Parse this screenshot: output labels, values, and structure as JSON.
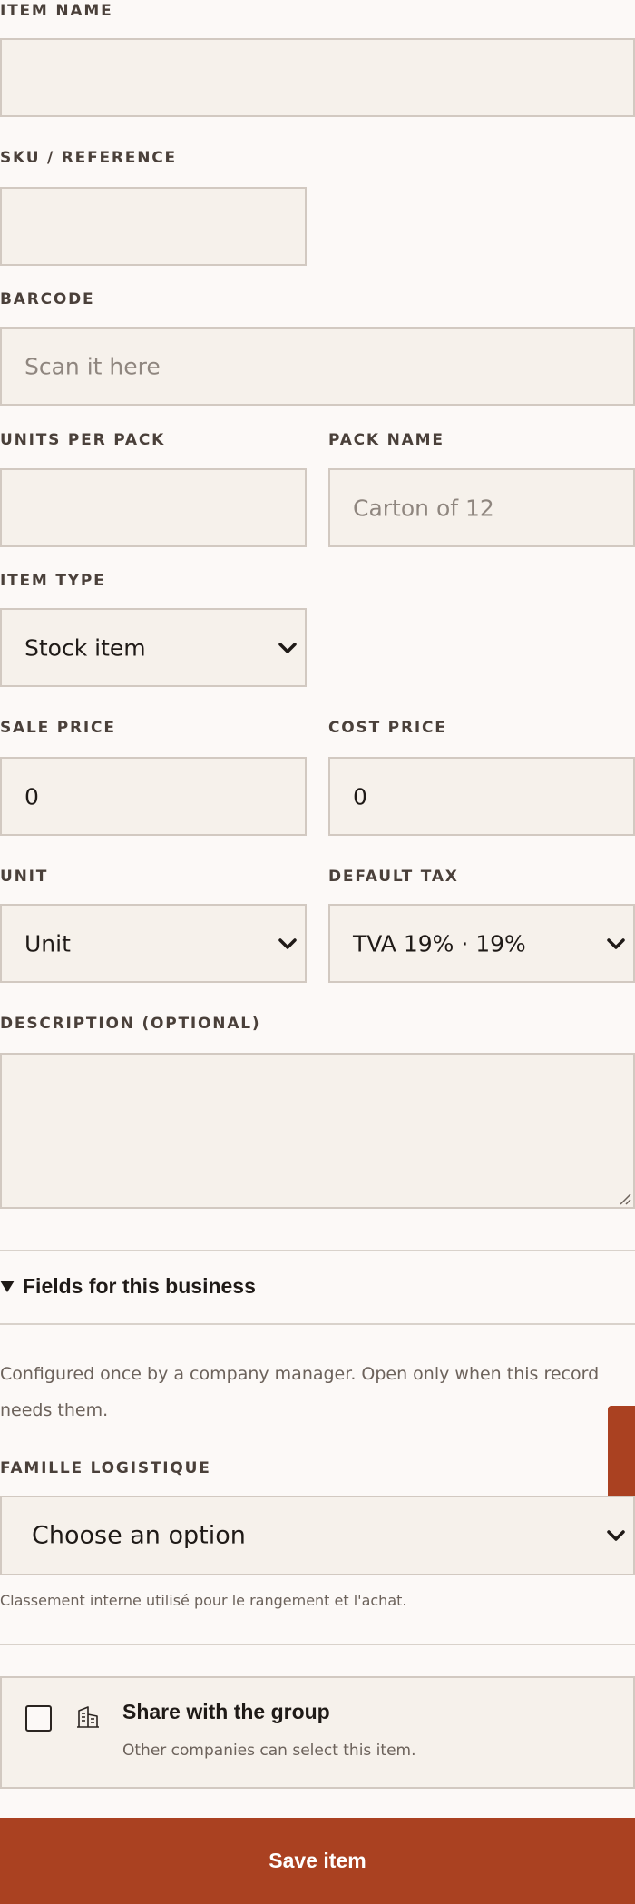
{
  "fields": {
    "item_name": {
      "label": "ITEM NAME",
      "value": ""
    },
    "sku": {
      "label": "SKU / REFERENCE",
      "value": ""
    },
    "barcode": {
      "label": "BARCODE",
      "placeholder": "Scan it here"
    },
    "units_per_pack": {
      "label": "UNITS PER PACK",
      "value": ""
    },
    "pack_name": {
      "label": "PACK NAME",
      "placeholder": "Carton of 12"
    },
    "item_type": {
      "label": "ITEM TYPE",
      "value": "Stock item"
    },
    "sale_price": {
      "label": "SALE PRICE",
      "value": "0"
    },
    "cost_price": {
      "label": "COST PRICE",
      "value": "0"
    },
    "unit": {
      "label": "UNIT",
      "value": "Unit"
    },
    "default_tax": {
      "label": "DEFAULT TAX",
      "value": "TVA 19% · 19%"
    },
    "description": {
      "label": "DESCRIPTION (OPTIONAL)",
      "value": ""
    }
  },
  "business_fields": {
    "summary": "Fields for this business",
    "help": "Configured once by a company manager. Open only when this record needs them.",
    "famille": {
      "label": "FAMILLE LOGISTIQUE",
      "value": "Choose an option",
      "hint": "Classement interne utilisé pour le rangement et l'achat."
    }
  },
  "share": {
    "title": "Share with the group",
    "subtitle": "Other companies can select this item.",
    "checked": false
  },
  "actions": {
    "save_label": "Save item"
  },
  "colors": {
    "accent": "#aa4121",
    "field_bg": "#f6f1eb",
    "border": "#d2c9c1",
    "page_bg": "#fcf9f7"
  },
  "icons": {
    "select_chevron": "chevron-down-icon",
    "share": "building-icon",
    "summary": "triangle-down-icon"
  }
}
